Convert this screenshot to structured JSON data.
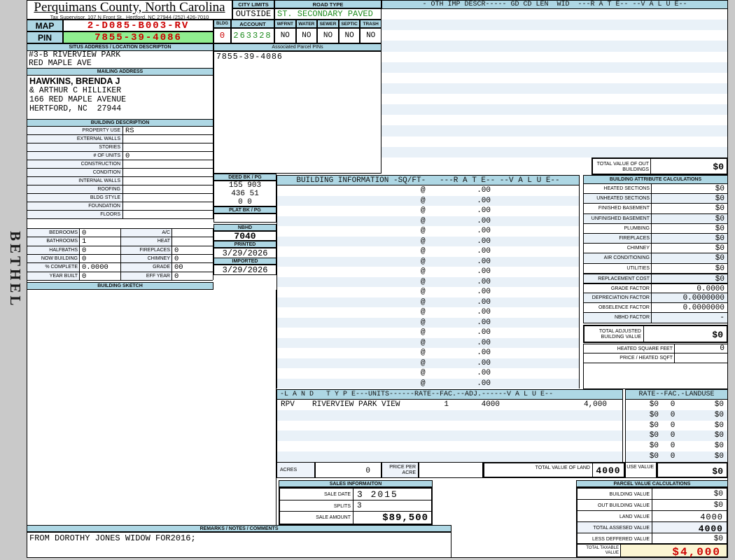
{
  "colors": {
    "header_blue": "#aed7e4",
    "stripe_blue": "#e9f1f8",
    "label_bg": "#eef3fa",
    "pin_green_bg": "#90ee90",
    "value_red": "#cc0000",
    "value_green": "#1e8c1e",
    "taxable_bg": "#fbf5d3",
    "page_gray": "#c9c9c9"
  },
  "header": {
    "title": "Perquimans County, North Carolina",
    "subtitle": "Tax Supervisor, 107 N Front St., Hertford, NC 27944  (252) 426-7010",
    "township": "BETHEL"
  },
  "city_road": {
    "city_limits_label": "CITY LIMITS",
    "city_limits_value": "OUTSIDE",
    "road_type_label": "ROAD TYPE",
    "road_type_value": "ST. SECONDARY PAVED"
  },
  "parcel_id": {
    "map_label": "MAP",
    "map_value": "2-D085-B003-RV",
    "pin_label": "PIN",
    "pin_value": "7855-39-4086",
    "bldg_label": "BLDG",
    "bldg_value": "0",
    "account_label": "ACCOUNT",
    "account_value": "263328",
    "flags": [
      {
        "label": "WFRNT",
        "value": "NO"
      },
      {
        "label": "WATER",
        "value": "NO"
      },
      {
        "label": "SEWER",
        "value": "NO"
      },
      {
        "label": "SEPTIC",
        "value": "NO"
      },
      {
        "label": "TRASH",
        "value": "NO"
      }
    ]
  },
  "situs": {
    "header": "SITUS ADDRESS / LOCATION DESCRIPTON",
    "line1": "#3-B RIVERVIEW PARK",
    "line2": "RED MAPLE AVE"
  },
  "associated_pins": {
    "header": "Associated Parcel PINs",
    "value": "7855-39-4086"
  },
  "mailing": {
    "header": "MAILING ADDRESS",
    "name": "HAWKINS, BRENDA J",
    "line2": "& ARTHUR C HILLIKER",
    "line3": "166 RED MAPLE AVENUE",
    "line4": "HERTFORD, NC  27944"
  },
  "building_description": {
    "header": "BUILDING DESCRIPTION",
    "rows": [
      {
        "label": "PROPERTY USE",
        "value": "RS"
      },
      {
        "label": "EXTERNAL WALLS",
        "value": ""
      },
      {
        "label": "STORIES",
        "value": ""
      },
      {
        "label": "# OF UNITS",
        "value": "0"
      },
      {
        "label": "CONSTRUCTION",
        "value": ""
      },
      {
        "label": "CONDITION",
        "value": ""
      },
      {
        "label": "INTERNAL WALLS",
        "value": ""
      },
      {
        "label": "ROOFING",
        "value": ""
      },
      {
        "label": "BLDG STYLE",
        "value": ""
      },
      {
        "label": "FOUNDATION",
        "value": ""
      },
      {
        "label": "FLOORS",
        "value": ""
      }
    ]
  },
  "building_counts": {
    "rows": [
      {
        "l_label": "BEDROOMS",
        "l_value": "0",
        "r_label": "A/C",
        "r_value": ""
      },
      {
        "l_label": "BATHROOMS",
        "l_value": "1",
        "r_label": "HEAT",
        "r_value": ""
      },
      {
        "l_label": "HALFBATHS",
        "l_value": "0",
        "r_label": "FIREPLACES",
        "r_value": "0"
      },
      {
        "l_label": "NOW BUILDING",
        "l_value": "0",
        "r_label": "CHIMNEY",
        "r_value": "0"
      },
      {
        "l_label": "% COMPLETE",
        "l_value": "0.0000",
        "r_label": "GRADE",
        "r_value": "00"
      },
      {
        "l_label": "YEAR BUILT",
        "l_value": "0",
        "r_label": "EFF YEAR",
        "r_value": "0"
      }
    ]
  },
  "sketch": {
    "header": "BUILDING SKETCH"
  },
  "deed": {
    "deed_header": "DEED BK / PG",
    "deed_line1": "155 903",
    "deed_line2": "436 51",
    "deed_line3": "0 0",
    "plat_header": "PLAT BK / PG",
    "plat_value": "",
    "nbhd_header": "NBHD",
    "nbhd_value": "7040",
    "printed_header": "PRINTED",
    "printed_value": "3/29/2026",
    "imported_header": "IMPORTED",
    "imported_value": "3/29/2026"
  },
  "oth_imp": {
    "header": "- OTH IMP DESCR----- GD CD LEN  WID  ---R A T E-- --V A L U E--",
    "empty_row_count": 14,
    "total_label": "TOTAL VALUE OF OUT BUILDINGS",
    "total_value": "$0"
  },
  "building_information": {
    "header": "BUILDING INFORMATION -SQ/FT-   ---R A T E-- --V A L U E--",
    "row_count": 20,
    "unit_symbol": "@",
    "rate_text": ".00"
  },
  "building_attributes": {
    "header": "BUILDING ATTRIBUTE CALCULATIONS",
    "rows": [
      {
        "label": "HEATED SECTIONS",
        "value": "$0"
      },
      {
        "label": "UNHEATED SECTIONS",
        "value": "$0"
      },
      {
        "label": "FINISHED BASEMENT",
        "value": "$0"
      },
      {
        "label": "UNFINISHED BASEMENT",
        "value": "$0"
      },
      {
        "label": "PLUMBING",
        "value": "$0"
      },
      {
        "label": "FIREPLACES",
        "value": "$0"
      },
      {
        "label": "CHIMNEY",
        "value": "$0"
      },
      {
        "label": "AIR CONDITIONING",
        "value": "$0"
      },
      {
        "label": "UTILITIES",
        "value": "$0"
      },
      {
        "label": "REPLACEMENT COST",
        "value": "$0"
      },
      {
        "label": "GRADE FACTOR",
        "value": "0.0000"
      },
      {
        "label": "DEPRECIATION FACTOR",
        "value": "0.0000000"
      },
      {
        "label": "OBSELENCE FACTOR",
        "value": "0.0000000"
      },
      {
        "label": "NBHD FACTOR",
        "value": "-"
      }
    ],
    "total_label": "TOTAL ADJUSTED BUILDING VALUE",
    "total_value": "$0",
    "heated_sqft_label": "HEATED SQUARE FEET",
    "heated_sqft_value": "0",
    "price_sqft_label": "PRICE / HEATED SQFT",
    "price_sqft_value": ""
  },
  "land": {
    "header_left": "-L A N D   T Y P E---UNITS------RATE--FAC.--ADJ.------V A L U E--",
    "header_right": "RATE--FAC.-LANDUSE",
    "rows": [
      {
        "code": "RPV",
        "desc": "RIVERVIEW PARK VIEW",
        "units": "1",
        "rate": "4000",
        "value": "4,000",
        "use_rate": "$0",
        "use_fac": "0",
        "use_landuse": "$0"
      },
      {
        "code": "",
        "desc": "",
        "units": "",
        "rate": "",
        "value": "",
        "use_rate": "$0",
        "use_fac": "0",
        "use_landuse": "$0"
      },
      {
        "code": "",
        "desc": "",
        "units": "",
        "rate": "",
        "value": "",
        "use_rate": "$0",
        "use_fac": "0",
        "use_landuse": "$0"
      },
      {
        "code": "",
        "desc": "",
        "units": "",
        "rate": "",
        "value": "",
        "use_rate": "$0",
        "use_fac": "0",
        "use_landuse": "$0"
      },
      {
        "code": "",
        "desc": "",
        "units": "",
        "rate": "",
        "value": "",
        "use_rate": "$0",
        "use_fac": "0",
        "use_landuse": "$0"
      },
      {
        "code": "",
        "desc": "",
        "units": "",
        "rate": "",
        "value": "",
        "use_rate": "$0",
        "use_fac": "0",
        "use_landuse": "$0"
      }
    ],
    "acres_label": "ACRES",
    "acres_value": "0",
    "price_per_acre_label": "PRICE PER ACRE",
    "price_per_acre_value": "",
    "total_land_label": "TOTAL VALUE OF LAND",
    "total_land_value": "4000",
    "use_value_label": "USE VALUE",
    "use_value_value": "$0"
  },
  "sales": {
    "header": "SALES INFORMAITON",
    "rows": [
      {
        "label": "SALE DATE",
        "value": "3 2015"
      },
      {
        "label": "SPLITS",
        "value": "3"
      },
      {
        "label": "SALE AMOUNT",
        "value": "$89,500"
      }
    ]
  },
  "parcel_values": {
    "header": "PARCEL VALUE CALCULATIONS",
    "rows": [
      {
        "label": "BUILDING VALUE",
        "value": "$0"
      },
      {
        "label": "OUT BUILDING VALUE",
        "value": "$0"
      },
      {
        "label": "LAND VALUE",
        "value": "4000"
      },
      {
        "label": "TOTAL ASSESED VALUE",
        "value": "4000"
      },
      {
        "label": "LESS DEFFERED VALUE",
        "value": "$0"
      }
    ],
    "taxable_label": "TOTAL TAXABLE VALUE",
    "taxable_value": "$4,000"
  },
  "remarks": {
    "header": "REMARKS / NOTES / COMMENTS",
    "text": "FROM DOROTHY JONES WIDOW FOR2016;"
  }
}
